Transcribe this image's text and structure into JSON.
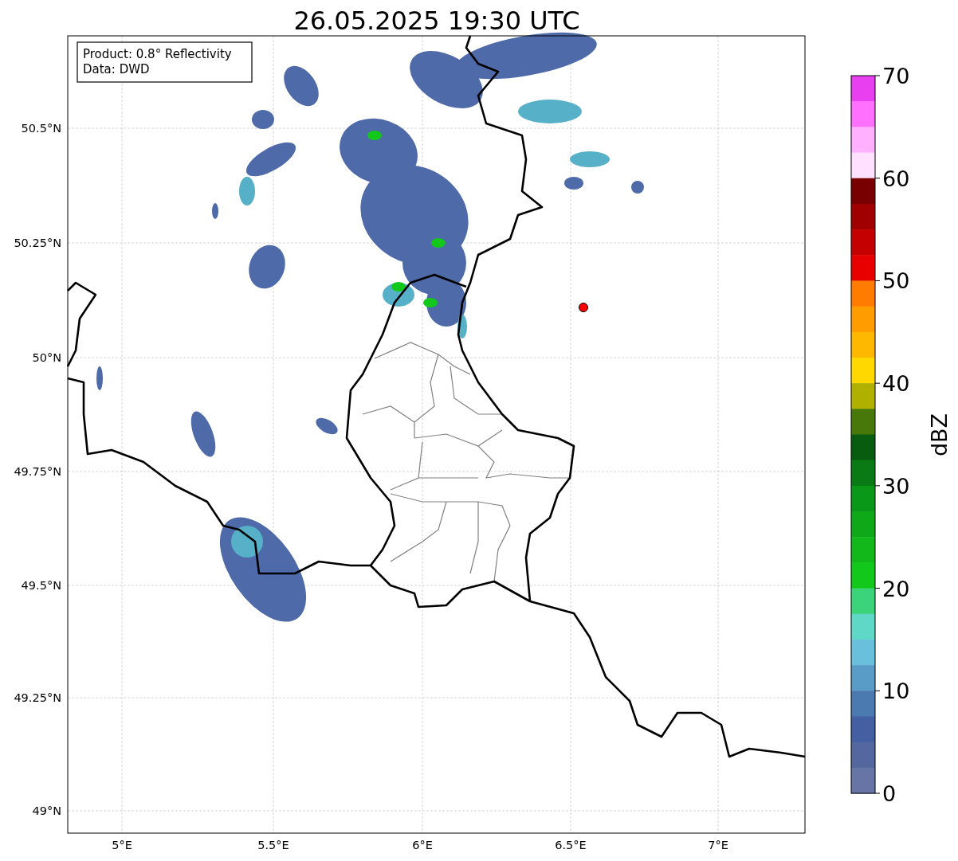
{
  "title": "26.05.2025 19:30 UTC",
  "info_box": {
    "lines": [
      "Product: 0.8° Reflectivity",
      "Data: DWD"
    ]
  },
  "x_ticks": [
    "5°E",
    "5.5°E",
    "6°E",
    "6.5°E",
    "7°E"
  ],
  "y_ticks": [
    "50.5°N",
    "50.25°N",
    "50°N",
    "49.75°N",
    "49.5°N",
    "49.25°N",
    "49°N"
  ],
  "colorbar": {
    "label": "dBZ",
    "ticks": [
      "70",
      "60",
      "50",
      "40",
      "30",
      "20",
      "10",
      "0"
    ],
    "segments": [
      {
        "color": "#e840f0"
      },
      {
        "color": "#ff70ff"
      },
      {
        "color": "#ffb0ff"
      },
      {
        "color": "#ffe0ff"
      },
      {
        "color": "#780000"
      },
      {
        "color": "#a00000"
      },
      {
        "color": "#c40000"
      },
      {
        "color": "#e60000"
      },
      {
        "color": "#ff7c00"
      },
      {
        "color": "#ff9c00"
      },
      {
        "color": "#ffb800"
      },
      {
        "color": "#ffd800"
      },
      {
        "color": "#b0b000"
      },
      {
        "color": "#48780a"
      },
      {
        "color": "#085c10"
      },
      {
        "color": "#0a7a14"
      },
      {
        "color": "#0a9818"
      },
      {
        "color": "#0ea818"
      },
      {
        "color": "#12b81a"
      },
      {
        "color": "#12c81a"
      },
      {
        "color": "#3cd47a"
      },
      {
        "color": "#60d8c8"
      },
      {
        "color": "#68c0dc"
      },
      {
        "color": "#5a9cc8"
      },
      {
        "color": "#4a7ab0"
      },
      {
        "color": "#4460a2"
      },
      {
        "color": "#54689f"
      },
      {
        "color": "#6675a6"
      }
    ]
  }
}
